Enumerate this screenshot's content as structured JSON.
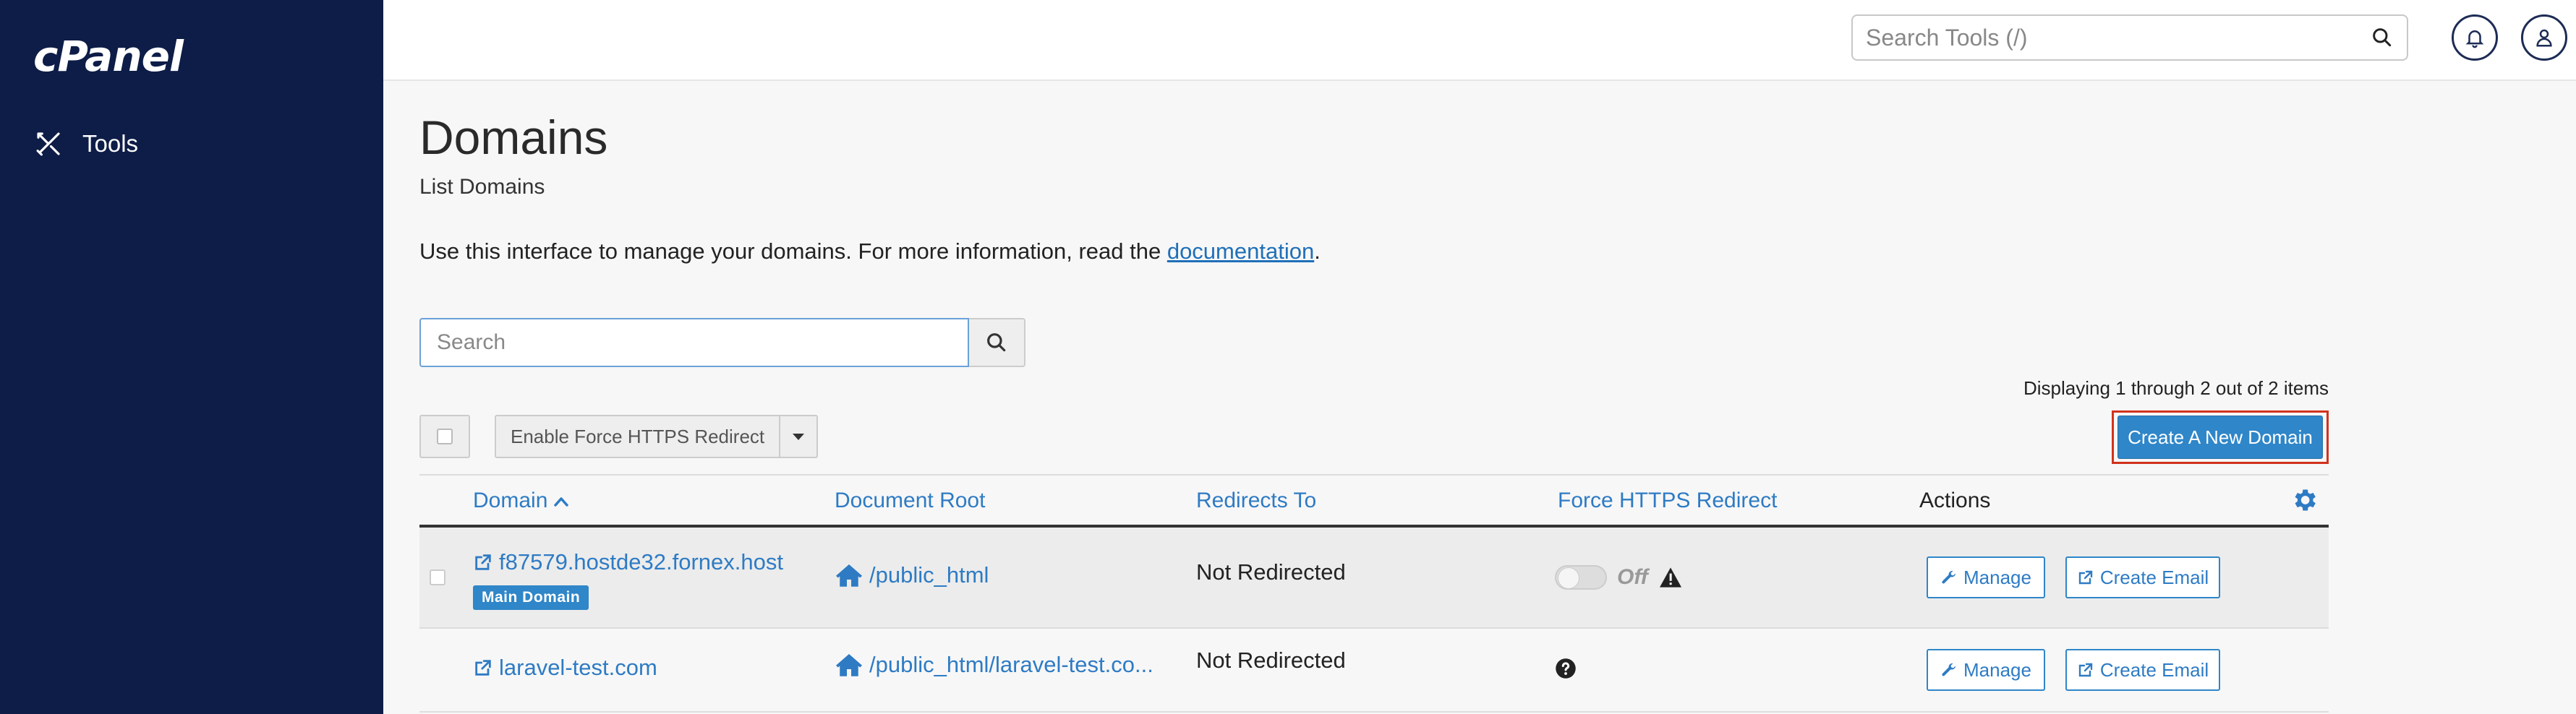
{
  "sidebar": {
    "logo": "cPanel",
    "items": [
      {
        "label": "Tools",
        "icon": "tools-icon"
      }
    ]
  },
  "topbar": {
    "search_placeholder": "Search Tools (/)",
    "icons": [
      "search-icon",
      "bell-icon",
      "user-icon"
    ]
  },
  "page": {
    "title": "Domains",
    "subtitle": "List Domains",
    "intro_prefix": "Use this interface to manage your domains. For more information, read the ",
    "intro_link": "documentation",
    "intro_suffix": "."
  },
  "list": {
    "search_placeholder": "Search",
    "displaying": "Displaying 1 through 2 out of 2 items",
    "bulk_action_label": "Enable Force HTTPS Redirect",
    "create_button": "Create A New Domain"
  },
  "table": {
    "columns": [
      "Domain",
      "Document Root",
      "Redirects To",
      "Force HTTPS Redirect",
      "Actions"
    ],
    "sort_indicator": "^",
    "rows": [
      {
        "domain": "f87579.hostde32.fornex.host",
        "badge": "Main Domain",
        "document_root": "/public_html",
        "redirects_to": "Not Redirected",
        "https_state": "Off",
        "https_icon": "warning-icon",
        "actions": [
          "Manage",
          "Create Email"
        ]
      },
      {
        "domain": "laravel-test.com",
        "document_root": "/public_html/laravel-test.co...",
        "redirects_to": "Not Redirected",
        "https_icon": "question-icon",
        "actions": [
          "Manage",
          "Create Email"
        ]
      }
    ]
  },
  "colors": {
    "sidebar_bg": "#0d1d47",
    "accent": "#2f86c8",
    "link": "#2e7bc4",
    "highlight_outline": "#d2321c"
  }
}
